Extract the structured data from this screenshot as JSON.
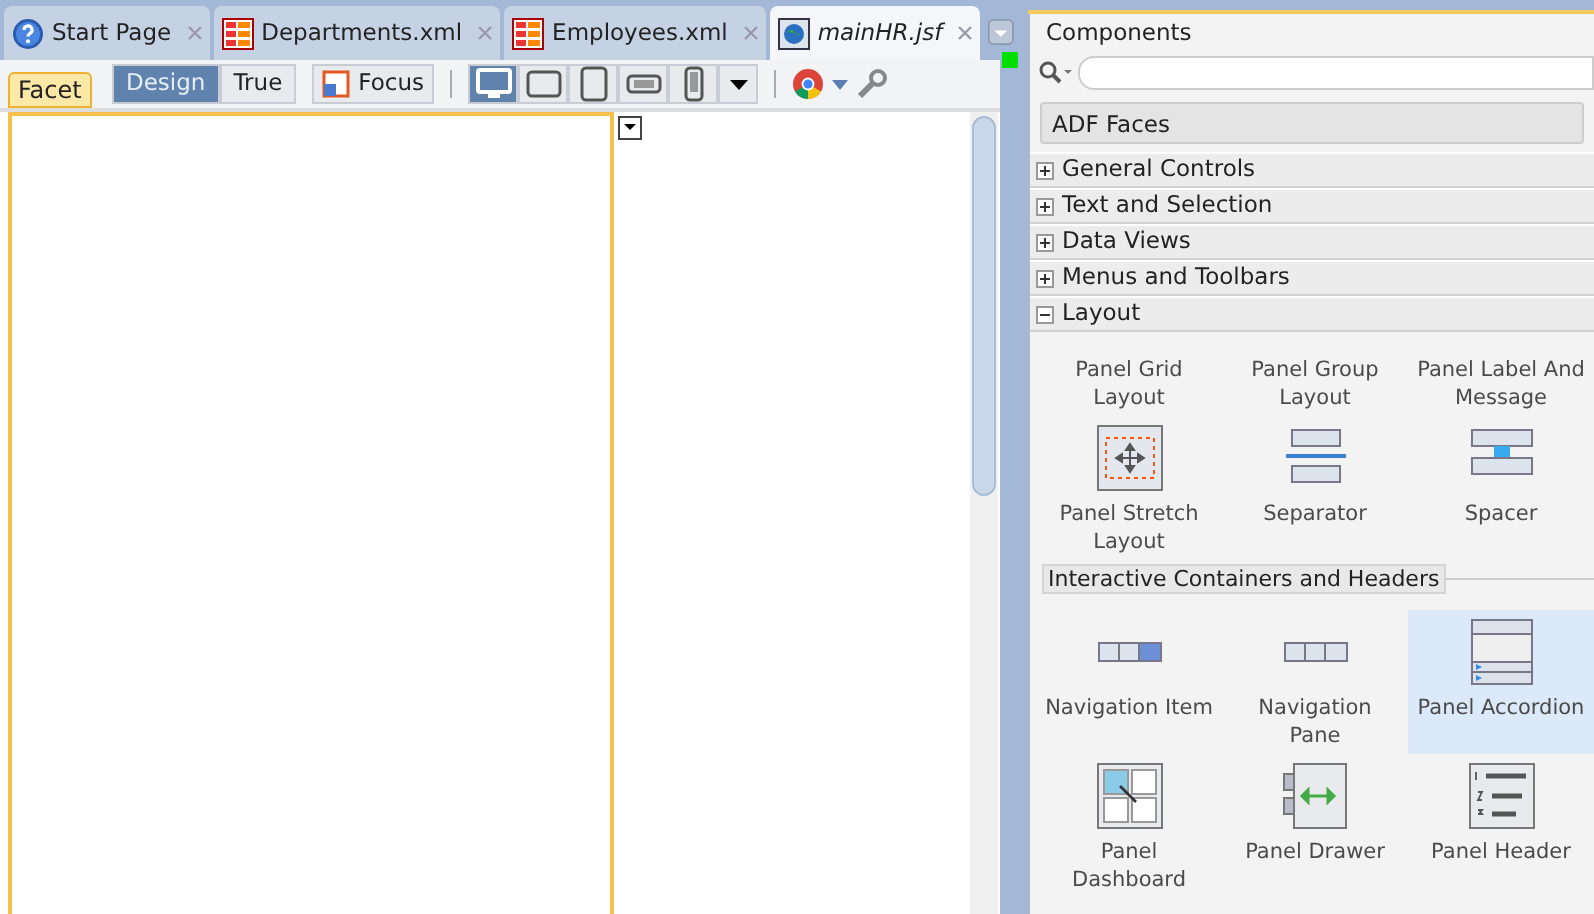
{
  "tabs": [
    {
      "label": "Start Page",
      "kind": "help",
      "selected": false,
      "modified": false
    },
    {
      "label": "Departments.xml",
      "kind": "xml",
      "selected": false,
      "modified": false
    },
    {
      "label": "Employees.xml",
      "kind": "xml",
      "selected": false,
      "modified": false
    },
    {
      "label": "mainHR.jsf",
      "kind": "jsf",
      "selected": true,
      "modified": true
    }
  ],
  "toolbar": {
    "facet_tab": "Facet",
    "modes": [
      {
        "label": "Design",
        "selected": true
      },
      {
        "label": "True",
        "selected": false
      }
    ],
    "focus": "Focus",
    "devices": [
      {
        "kind": "desktop",
        "selected": true
      },
      {
        "kind": "tablet-wide",
        "selected": false
      },
      {
        "kind": "tablet",
        "selected": false
      },
      {
        "kind": "phone-wide",
        "selected": false
      },
      {
        "kind": "phone",
        "selected": false
      }
    ]
  },
  "components": {
    "title": "Components",
    "library": "ADF Faces",
    "categories": [
      {
        "label": "General Controls",
        "expanded": false
      },
      {
        "label": "Text and Selection",
        "expanded": false
      },
      {
        "label": "Data Views",
        "expanded": false
      },
      {
        "label": "Menus and Toolbars",
        "expanded": false
      },
      {
        "label": "Layout",
        "expanded": true
      }
    ],
    "layout_items": [
      {
        "label": "Panel Grid Layout",
        "kind": "none",
        "selected": false
      },
      {
        "label": "Panel Group Layout",
        "kind": "none",
        "selected": false
      },
      {
        "label": "Panel Label And Message",
        "kind": "none",
        "selected": false
      },
      {
        "label": "Panel Stretch Layout",
        "kind": "stretch",
        "selected": false
      },
      {
        "label": "Separator",
        "kind": "separator",
        "selected": false
      },
      {
        "label": "Spacer",
        "kind": "spacer",
        "selected": false
      }
    ],
    "section": "Interactive Containers and Headers",
    "section_items": [
      {
        "label": "Navigation Item",
        "kind": "navitem",
        "selected": false
      },
      {
        "label": "Navigation Pane",
        "kind": "navpane",
        "selected": false
      },
      {
        "label": "Panel Accordion",
        "kind": "accordion",
        "selected": true
      },
      {
        "label": "Panel Dashboard",
        "kind": "dashboard",
        "selected": false
      },
      {
        "label": "Panel Drawer",
        "kind": "drawer",
        "selected": false
      },
      {
        "label": "Panel Header",
        "kind": "header",
        "selected": false
      }
    ]
  }
}
